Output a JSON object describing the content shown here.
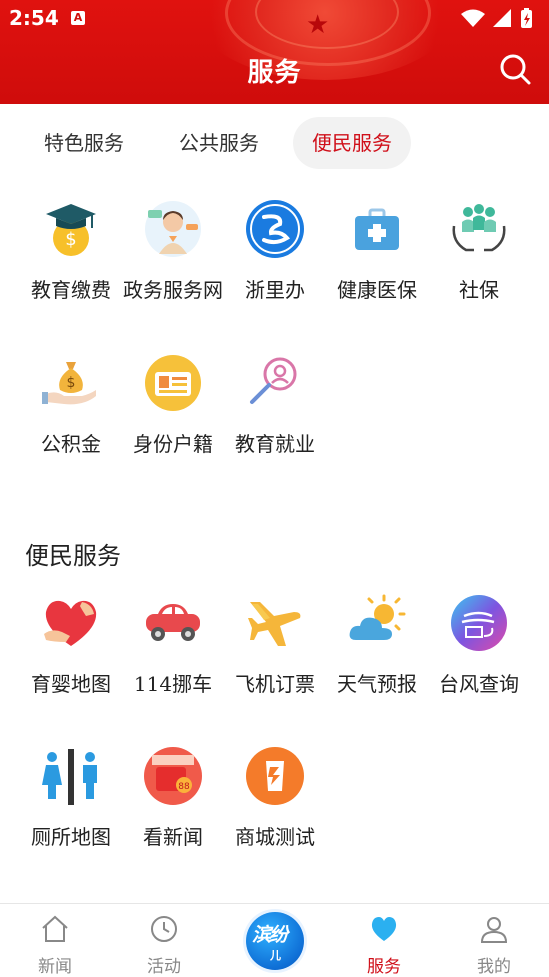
{
  "status_bar": {
    "time": "2:54"
  },
  "header": {
    "title": "服务"
  },
  "tabs": [
    {
      "label": "特色服务",
      "active": false
    },
    {
      "label": "公共服务",
      "active": false
    },
    {
      "label": "便民服务",
      "active": true
    }
  ],
  "services_row1": [
    {
      "label": "教育缴费",
      "icon": "graduation-coin-icon"
    },
    {
      "label": "政务服务网",
      "icon": "service-staff-icon"
    },
    {
      "label": "浙里办",
      "icon": "zheliban-logo-icon"
    },
    {
      "label": "健康医保",
      "icon": "medical-kit-icon"
    },
    {
      "label": "社保",
      "icon": "people-hands-icon"
    }
  ],
  "services_row2": [
    {
      "label": "公积金",
      "icon": "money-bag-hand-icon"
    },
    {
      "label": "身份户籍",
      "icon": "id-card-icon"
    },
    {
      "label": "教育就业",
      "icon": "search-person-icon"
    }
  ],
  "section_title": "便民服务",
  "convenience_row1": [
    {
      "label": "育婴地图",
      "icon": "heart-hands-icon"
    },
    {
      "label": "114挪车",
      "icon": "car-icon"
    },
    {
      "label": "飞机订票",
      "icon": "airplane-icon"
    },
    {
      "label": "天气预报",
      "icon": "sun-cloud-icon"
    },
    {
      "label": "台风查询",
      "icon": "typhoon-icon"
    }
  ],
  "convenience_row2": [
    {
      "label": "厕所地图",
      "icon": "restroom-icon"
    },
    {
      "label": "看新闻",
      "icon": "news-promo-icon"
    },
    {
      "label": "商城测试",
      "icon": "mall-icon"
    }
  ],
  "bottom_nav": [
    {
      "label": "新闻",
      "icon": "home-icon"
    },
    {
      "label": "活动",
      "icon": "clock-icon"
    },
    {
      "label": "服务",
      "icon": "heart-icon",
      "active": true
    },
    {
      "label": "我的",
      "icon": "user-icon"
    }
  ],
  "colors": {
    "brand_red": "#d0101a",
    "header_red": "#dc120e"
  }
}
